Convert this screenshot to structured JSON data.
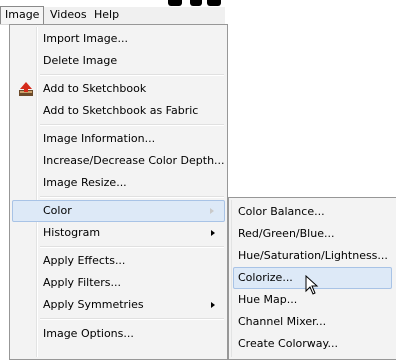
{
  "menubar": {
    "items": [
      {
        "label": "Image",
        "active": true
      },
      {
        "label": "Videos",
        "active": false
      },
      {
        "label": "Help",
        "active": false
      }
    ]
  },
  "image_menu": {
    "items": [
      {
        "label": "Import Image...",
        "submenu": false
      },
      {
        "label": "Delete Image",
        "submenu": false
      },
      {
        "label": "Add to Sketchbook",
        "submenu": false,
        "icon": "sketchbook-icon"
      },
      {
        "label": "Add to Sketchbook as Fabric",
        "submenu": false
      },
      {
        "label": "Image Information...",
        "submenu": false
      },
      {
        "label": "Increase/Decrease Color Depth...",
        "submenu": false
      },
      {
        "label": "Image Resize...",
        "submenu": false
      },
      {
        "label": "Color",
        "submenu": true,
        "highlighted": true
      },
      {
        "label": "Histogram",
        "submenu": true
      },
      {
        "label": "Apply Effects...",
        "submenu": false
      },
      {
        "label": "Apply Filters...",
        "submenu": false
      },
      {
        "label": "Apply Symmetries",
        "submenu": true
      },
      {
        "label": "Image Options...",
        "submenu": false
      }
    ]
  },
  "color_submenu": {
    "items": [
      {
        "label": "Color Balance..."
      },
      {
        "label": "Red/Green/Blue..."
      },
      {
        "label": "Hue/Saturation/Lightness..."
      },
      {
        "label": "Colorize...",
        "highlighted": true
      },
      {
        "label": "Hue Map..."
      },
      {
        "label": "Channel Mixer..."
      },
      {
        "label": "Create Colorway..."
      }
    ]
  },
  "colors": {
    "highlight_bg": "#dde9f7",
    "highlight_border": "#a8c3e6",
    "menu_bg": "#f3f3f3"
  }
}
